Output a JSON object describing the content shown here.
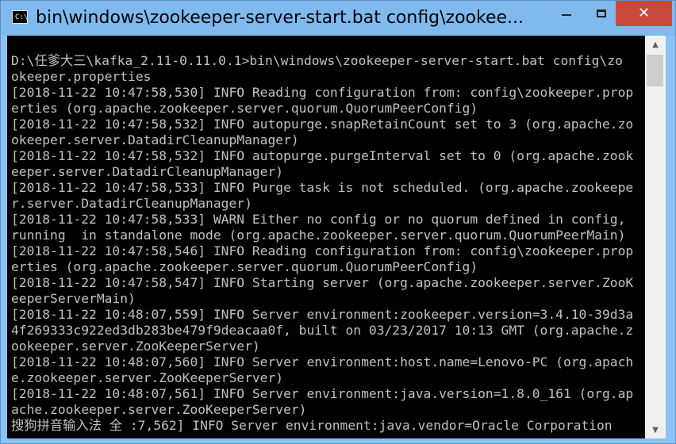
{
  "window": {
    "title": "bin\\windows\\zookeeper-server-start.bat  config\\zookee...",
    "app_icon": "terminal-icon",
    "controls": {
      "minimize": "minimize-icon",
      "maximize": "maximize-icon",
      "close": "close-icon",
      "close_glyph": "✕"
    }
  },
  "console": {
    "lines": [
      "D:\\任爹大三\\kafka_2.11-0.11.0.1>bin\\windows\\zookeeper-server-start.bat config\\zo",
      "okeeper.properties",
      "[2018-11-22 10:47:58,530] INFO Reading configuration from: config\\zookeeper.prop",
      "erties (org.apache.zookeeper.server.quorum.QuorumPeerConfig)",
      "[2018-11-22 10:47:58,532] INFO autopurge.snapRetainCount set to 3 (org.apache.zo",
      "okeeper.server.DatadirCleanupManager)",
      "[2018-11-22 10:47:58,532] INFO autopurge.purgeInterval set to 0 (org.apache.zook",
      "eeper.server.DatadirCleanupManager)",
      "[2018-11-22 10:47:58,533] INFO Purge task is not scheduled. (org.apache.zookeepe",
      "r.server.DatadirCleanupManager)",
      "[2018-11-22 10:47:58,533] WARN Either no config or no quorum defined in config,",
      "running  in standalone mode (org.apache.zookeeper.server.quorum.QuorumPeerMain)",
      "[2018-11-22 10:47:58,546] INFO Reading configuration from: config\\zookeeper.prop",
      "erties (org.apache.zookeeper.server.quorum.QuorumPeerConfig)",
      "[2018-11-22 10:47:58,547] INFO Starting server (org.apache.zookeeper.server.ZooK",
      "eeperServerMain)",
      "[2018-11-22 10:48:07,559] INFO Server environment:zookeeper.version=3.4.10-39d3a",
      "4f269333c922ed3db283be479f9deacaa0f, built on 03/23/2017 10:13 GMT (org.apache.z",
      "ookeeper.server.ZooKeeperServer)",
      "[2018-11-22 10:48:07,560] INFO Server environment:host.name=Lenovo-PC (org.apach",
      "e.zookeeper.server.ZooKeeperServer)",
      "[2018-11-22 10:48:07,561] INFO Server environment:java.version=1.8.0_161 (org.ap",
      "ache.zookeeper.server.ZooKeeperServer)",
      "搜狗拼音输入法 全 :7,562] INFO Server environment:java.vendor=Oracle Corporation"
    ],
    "background": "#000000",
    "text_color": "#c0c0c0"
  },
  "scrollbar": {
    "up_glyph": "▲",
    "down_glyph": "▼"
  }
}
